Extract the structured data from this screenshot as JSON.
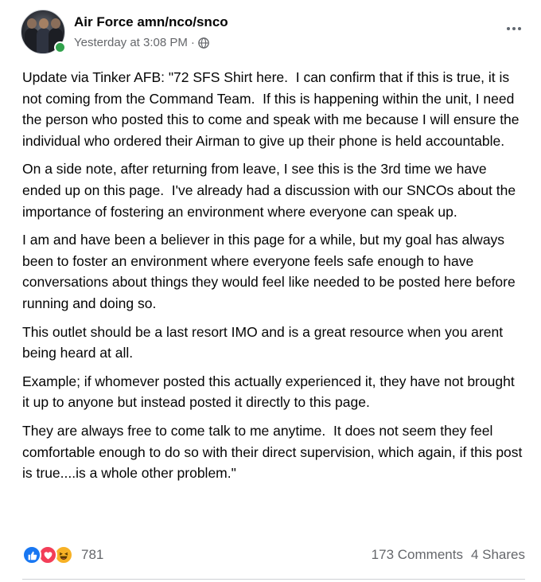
{
  "post": {
    "author": "Air Force amn/nco/snco",
    "timestamp": "Yesterday at 3:08 PM",
    "separator": "·",
    "audience_icon": "globe-icon",
    "more_icon": "more-options-icon",
    "paragraphs": [
      "Update via Tinker AFB: \"72 SFS Shirt here.  I can confirm that if this is true, it is not coming from the Command Team.  If this is happening within the unit, I need the person who posted this to come and speak with me because I will ensure the individual who ordered their Airman to give up their phone is held accountable.",
      "On a side note, after returning from leave, I see this is the 3rd time we have ended up on this page.  I've already had a discussion with our SNCOs about the importance of fostering an environment where everyone can speak up.",
      "I am and have been a believer in this page for a while, but my goal has always been to foster an environment where everyone feels safe enough to have conversations about things they would feel like needed to be posted here before running and doing so.",
      "This outlet should be a last resort IMO and is a great resource when you arent being heard at all.",
      "Example; if whomever posted this actually experienced it, they have not brought it up to anyone but instead posted it directly to this page.",
      "They are always free to come talk to me anytime.  It does not seem they feel comfortable enough to do so with their direct supervision, which again, if this post is true....is a whole other problem.\""
    ]
  },
  "engagement": {
    "reaction_icons": [
      "like-icon",
      "love-icon",
      "haha-icon"
    ],
    "reaction_count": "781",
    "comments": "173 Comments",
    "shares": "4 Shares"
  },
  "colors": {
    "like": "#1877f2",
    "love": "#f33e58",
    "haha": "#f7b125",
    "secondary_text": "#65676b",
    "online": "#31a24c"
  }
}
